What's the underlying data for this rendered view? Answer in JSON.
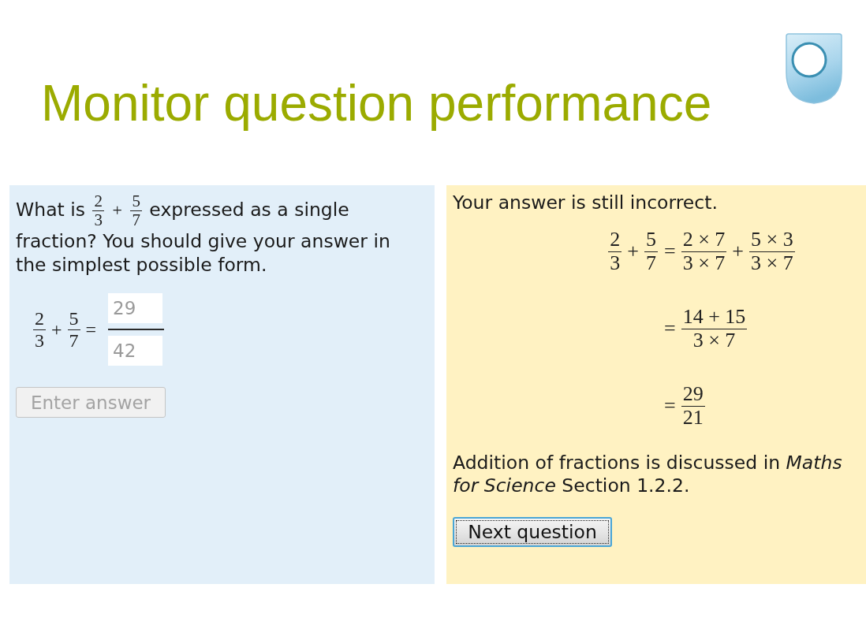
{
  "title": "Monitor question performance",
  "question": {
    "prompt": [
      {
        "kind": "text",
        "text": "What is"
      },
      {
        "kind": "fraction",
        "numerator": "2",
        "denominator": "3"
      },
      {
        "kind": "operator",
        "text": "+"
      },
      {
        "kind": "fraction",
        "numerator": "5",
        "denominator": "7"
      },
      {
        "kind": "text",
        "text": "expressed as a single fraction? You should give your answer in the simplest possible form."
      }
    ],
    "equation": [
      {
        "kind": "fraction",
        "numerator": "2",
        "denominator": "3"
      },
      {
        "kind": "operator",
        "text": "+"
      },
      {
        "kind": "fraction",
        "numerator": "5",
        "denominator": "7"
      },
      {
        "kind": "operator",
        "text": "="
      }
    ],
    "answer": {
      "numerator": {
        "value": "29",
        "disabled": true
      },
      "denominator": {
        "value": "42",
        "disabled": true
      }
    },
    "button": {
      "label": "Enter answer",
      "disabled": true
    }
  },
  "feedback": {
    "message": "Your answer is still incorrect.",
    "working": [
      {
        "lhs": [
          {
            "kind": "fraction",
            "numerator": "2",
            "denominator": "3"
          },
          {
            "kind": "operator",
            "text": "+"
          },
          {
            "kind": "fraction",
            "numerator": "5",
            "denominator": "7"
          }
        ],
        "rhs": [
          {
            "kind": "operator",
            "text": "="
          },
          {
            "kind": "fraction",
            "numerator": "2 × 7",
            "denominator": "3 × 7"
          },
          {
            "kind": "operator",
            "text": "+"
          },
          {
            "kind": "fraction",
            "numerator": "5 × 3",
            "denominator": "3 × 7"
          }
        ]
      },
      {
        "rhs": [
          {
            "kind": "operator",
            "text": "="
          },
          {
            "kind": "fraction",
            "numerator": "14 + 15",
            "denominator": "3 × 7"
          }
        ]
      },
      {
        "rhs": [
          {
            "kind": "operator",
            "text": "="
          },
          {
            "kind": "fraction",
            "numerator": "29",
            "denominator": "21"
          }
        ]
      }
    ],
    "reference": "Addition of fractions is discussed in *Maths for Science* Section 1.2.2.",
    "button": {
      "label": "Next question",
      "focused": true
    }
  }
}
